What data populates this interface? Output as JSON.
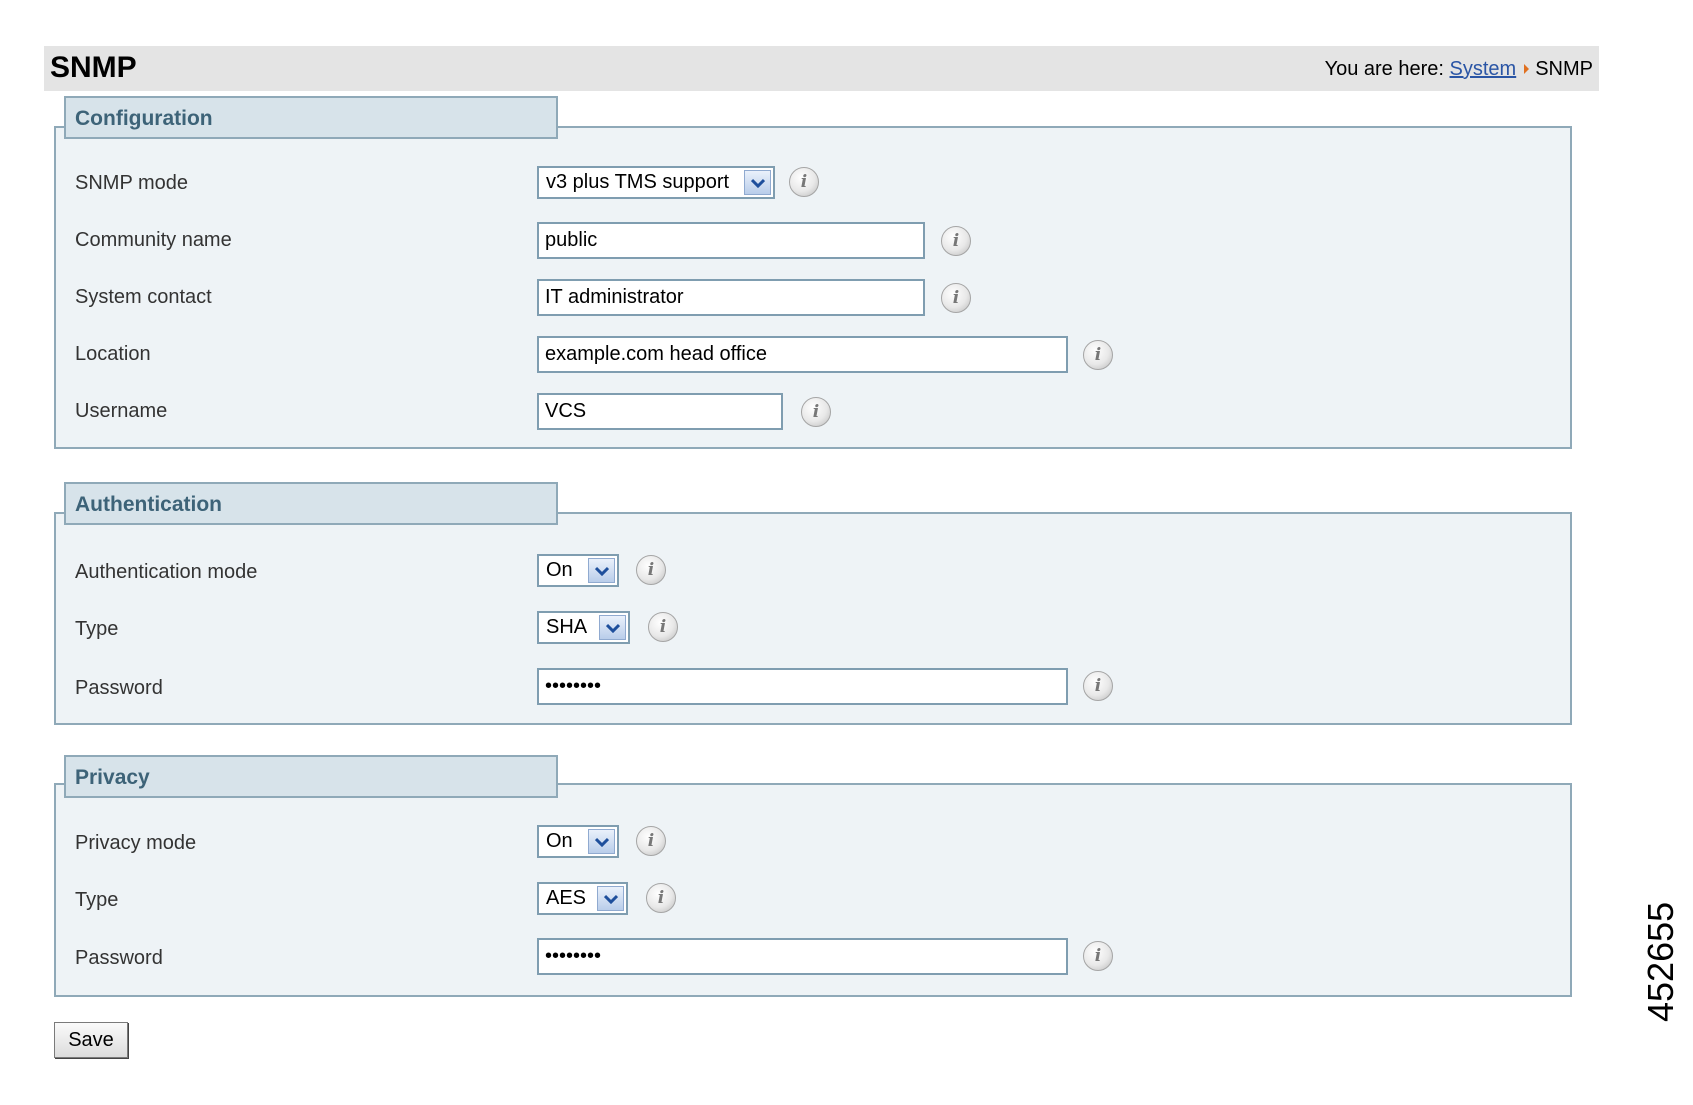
{
  "header": {
    "title": "SNMP",
    "breadcrumb_prefix": "You are here:",
    "breadcrumb_link": "System",
    "breadcrumb_current": "SNMP"
  },
  "configuration": {
    "title": "Configuration",
    "snmp_mode": {
      "label": "SNMP mode",
      "value": "v3 plus TMS support"
    },
    "community_name": {
      "label": "Community name",
      "value": "public"
    },
    "system_contact": {
      "label": "System contact",
      "value": "IT administrator"
    },
    "location": {
      "label": "Location",
      "value": "example.com head office"
    },
    "username": {
      "label": "Username",
      "value": "VCS"
    }
  },
  "authentication": {
    "title": "Authentication",
    "mode": {
      "label": "Authentication mode",
      "value": "On"
    },
    "type": {
      "label": "Type",
      "value": "SHA"
    },
    "password": {
      "label": "Password",
      "value": "••••••••"
    }
  },
  "privacy": {
    "title": "Privacy",
    "mode": {
      "label": "Privacy mode",
      "value": "On"
    },
    "type": {
      "label": "Type",
      "value": "AES"
    },
    "password": {
      "label": "Password",
      "value": "••••••••"
    }
  },
  "actions": {
    "save_label": "Save"
  },
  "info_glyph": "i",
  "figure_number": "452655",
  "icons": {
    "info": "info-icon",
    "dropdown": "chevron-down-icon",
    "breadcrumb_separator": "triangle-right-icon"
  },
  "colors": {
    "panel_background": "#eef3f6",
    "panel_border": "#8fa9b8",
    "section_title": "#3d6378",
    "link": "#2a55a5",
    "breadcrumb_arrow": "#e07020"
  }
}
